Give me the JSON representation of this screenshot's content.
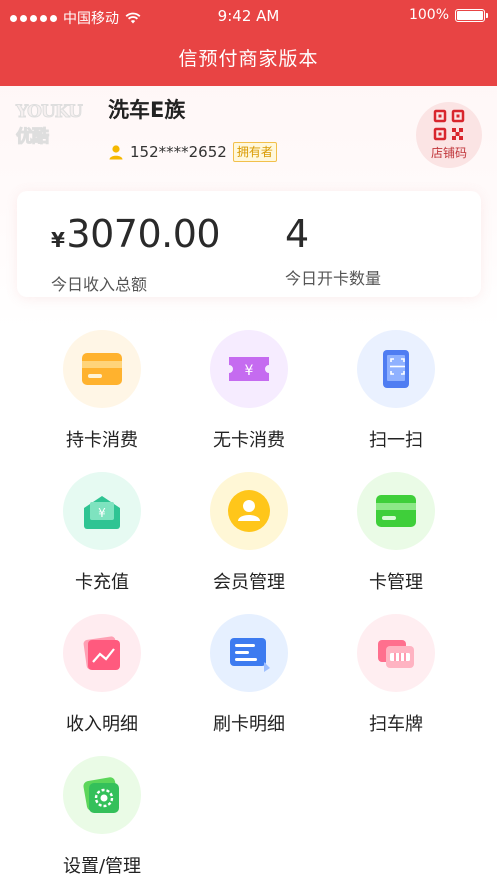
{
  "status_bar": {
    "carrier": "中国移动",
    "time": "9:42 AM",
    "battery": "100%"
  },
  "header": {
    "title": "信预付商家版本"
  },
  "shop": {
    "logo_text": "YOUKU优酷",
    "name": "洗车E族",
    "phone": "152****2652",
    "role_badge": "拥有者",
    "qr_label": "店铺码"
  },
  "stats": {
    "currency": "¥",
    "income_value": "3070.00",
    "income_label": "今日收入总额",
    "cards_value": "4",
    "cards_label": "今日开卡数量"
  },
  "menu": [
    {
      "label": "持卡消费",
      "icon": "card-payment-icon"
    },
    {
      "label": "无卡消费",
      "icon": "yen-ticket-icon"
    },
    {
      "label": "扫一扫",
      "icon": "scan-phone-icon"
    },
    {
      "label": "卡充值",
      "icon": "card-recharge-icon"
    },
    {
      "label": "会员管理",
      "icon": "member-icon"
    },
    {
      "label": "卡管理",
      "icon": "card-manage-icon"
    },
    {
      "label": "收入明细",
      "icon": "income-chart-icon"
    },
    {
      "label": "刷卡明细",
      "icon": "swipe-record-icon"
    },
    {
      "label": "扫车牌",
      "icon": "scan-plate-icon"
    },
    {
      "label": "设置/管理",
      "icon": "settings-icon"
    }
  ],
  "colors": {
    "brand_red": "#e84444",
    "badge_gold": "#f2c04b"
  }
}
